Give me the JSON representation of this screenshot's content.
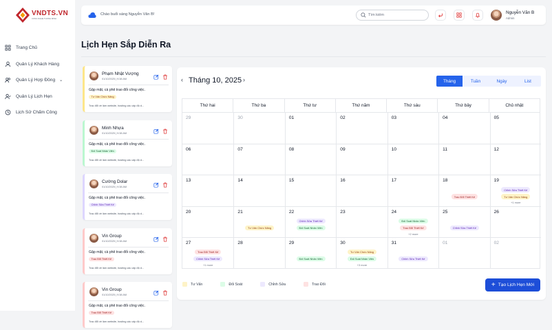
{
  "brand": {
    "name": "VNDTS.VN",
    "tagline": "CONG NGHE THONG MINH"
  },
  "sidebar": {
    "items": [
      {
        "id": "trang-chu",
        "label": "Trang Chủ",
        "icon": "grid-icon",
        "chevron": ""
      },
      {
        "id": "khach-hang",
        "label": "Quản Lý Khách Hàng",
        "icon": "user-icon",
        "chevron": ""
      },
      {
        "id": "hop-dong",
        "label": "Quản Lý Hợp Đồng",
        "icon": "users-icon",
        "chevron": "⌄"
      },
      {
        "id": "lich-hen",
        "label": "Quản Lý Lịch Hẹn",
        "icon": "user-check-icon",
        "chevron": ""
      },
      {
        "id": "cham-cong",
        "label": "Lịch Sử Chấm Công",
        "icon": "history-icon",
        "chevron": ""
      }
    ]
  },
  "header": {
    "greeting": "Chào buổi sáng Nguyễn Văn B!",
    "search_placeholder": "Tìm kiếm",
    "user_name": "Nguyễn Văn B",
    "user_role": "Admin",
    "icons": [
      "logout-icon",
      "apps-icon",
      "bell-icon"
    ]
  },
  "page": {
    "title": "Lịch Hẹn Sắp Diễn Ra"
  },
  "appointments": [
    {
      "name": "Phạm Nhật Vượng",
      "date": "01/10/2025 | 9:38 AM",
      "title": "Gặp mặt, cà phê trao đổi công việc.",
      "tag": "Tư Vấn Chức Năng",
      "category": "tuvan",
      "desc": "Trao đổi về làm website, hosting các cấp độ d..."
    },
    {
      "name": "Minh Nhựa",
      "date": "01/10/2025 | 9:38 AM",
      "title": "Gặp mặt, cà phê trao đổi công việc.",
      "tag": "Đối Soát Nhân Viên",
      "category": "doisoat",
      "desc": "Trao đổi về làm website, hosting các cấp độ d..."
    },
    {
      "name": "Cường Dolar",
      "date": "01/10/2025 | 9:38 AM",
      "title": "Gặp mặt, cà phê trao đổi công việc.",
      "tag": "Chỉnh Sửa Thiết Kế",
      "category": "chinhsua",
      "desc": "Trao đổi về làm website, hosting các cấp độ d..."
    },
    {
      "name": "Vin Group",
      "date": "01/10/2025 | 9:38 AM",
      "title": "Gặp mặt, cà phê trao đổi công việc.",
      "tag": "Trao Đổi Thiết Kế",
      "category": "traodoi",
      "desc": "Trao đổi về làm website, hosting các cấp độ d..."
    },
    {
      "name": "Vin Group",
      "date": "01/10/2025 | 9:38 AM",
      "title": "Gặp mặt, cà phê trao đổi công việc.",
      "tag": "Trao Đổi Thiết Kế",
      "category": "traodoi",
      "desc": "Trao đổi về làm website, hosting các cấp độ d..."
    }
  ],
  "calendar": {
    "month_label": "Tháng 10, 2025",
    "prev": "‹",
    "next": "›",
    "views": [
      "Tháng",
      "Tuần",
      "Ngày",
      "List"
    ],
    "active_view": "Tháng",
    "weekdays": [
      "Thứ hai",
      "Thứ ba",
      "Thứ tư",
      "Thứ năm",
      "Thứ sáu",
      "Thứ bảy",
      "Chủ nhật"
    ],
    "days": [
      "29",
      "30",
      "01",
      "02",
      "03",
      "04",
      "05",
      "06",
      "07",
      "08",
      "09",
      "10",
      "11",
      "12",
      "13",
      "14",
      "15",
      "16",
      "17",
      "18",
      "19",
      "20",
      "21",
      "22",
      "23",
      "24",
      "25",
      "26",
      "27",
      "28",
      "29",
      "30",
      "31",
      "01",
      "02"
    ],
    "muted_days": [
      0,
      1,
      33,
      34
    ],
    "events": [
      {
        "cell": 19,
        "row": 0,
        "label": "Trao Đổi Thiết Kế",
        "category": "traodoi"
      },
      {
        "cell": 20,
        "row": 0,
        "label": "Chỉnh Sửa Thiết Kế",
        "category": "chinhsua"
      },
      {
        "cell": 20,
        "row": 1,
        "label": "Tư Vấn Chức Năng",
        "category": "tuvan"
      },
      {
        "cell": 22,
        "row": 0,
        "label": "Tư Vấn Chức Năng",
        "category": "tuvan"
      },
      {
        "cell": 23,
        "row": 0,
        "label": "Chỉnh Sửa Thiết Kế",
        "category": "chinhsua"
      },
      {
        "cell": 23,
        "row": 1,
        "label": "Đối Soát Nhân Viên",
        "category": "doisoat"
      },
      {
        "cell": 25,
        "row": 0,
        "label": "Đối Soát Nhân Viên",
        "category": "doisoat"
      },
      {
        "cell": 25,
        "row": 1,
        "label": "Trao Đổi Thiết Kế",
        "category": "traodoi"
      },
      {
        "cell": 26,
        "row": 0,
        "label": "Chỉnh Sửa Thiết Kế",
        "category": "chinhsua"
      },
      {
        "cell": 28,
        "row": 0,
        "label": "Trao Đổi Thiết Kế",
        "category": "traodoi"
      },
      {
        "cell": 28,
        "row": 1,
        "label": "Chỉnh Sửa Thiết Kế",
        "category": "chinhsua"
      },
      {
        "cell": 30,
        "row": 0,
        "label": "Đối Soát Nhân Viên",
        "category": "doisoat"
      },
      {
        "cell": 31,
        "row": 0,
        "label": "Tư Vấn Chức Năng",
        "category": "tuvan"
      },
      {
        "cell": 31,
        "row": 1,
        "label": "Đối Soát Nhân Viên",
        "category": "doisoat"
      },
      {
        "cell": 32,
        "row": 0,
        "label": "Chỉnh Sửa Thiết Kế",
        "category": "chinhsua"
      }
    ],
    "more": [
      {
        "cell": 20,
        "label": "+1 more"
      },
      {
        "cell": 25,
        "label": "+2 more"
      },
      {
        "cell": 28,
        "label": "+1 more"
      },
      {
        "cell": 31,
        "label": "+3 more"
      }
    ]
  },
  "categories": {
    "tuvan": {
      "label": "Tư Vấn",
      "bg": "#fef3c7",
      "fg": "#92400e",
      "border": "#fde68a"
    },
    "doisoat": {
      "label": "Đối Soát",
      "bg": "#dcfce7",
      "fg": "#166534",
      "border": "#bbf7d0"
    },
    "chinhsua": {
      "label": "Chỉnh Sửa",
      "bg": "#ede9fe",
      "fg": "#5b21b6",
      "border": "#ddd6fe"
    },
    "traodoi": {
      "label": "Trao Đổi",
      "bg": "#fee2e2",
      "fg": "#991b1b",
      "border": "#fecaca"
    }
  },
  "legend_order": [
    "tuvan",
    "doisoat",
    "chinhsua",
    "traodoi"
  ],
  "actions": {
    "add_label": "Tạo Lịch Hẹn Mới"
  },
  "colors": {
    "accent": "#2563eb",
    "brand": "#c0272d"
  }
}
